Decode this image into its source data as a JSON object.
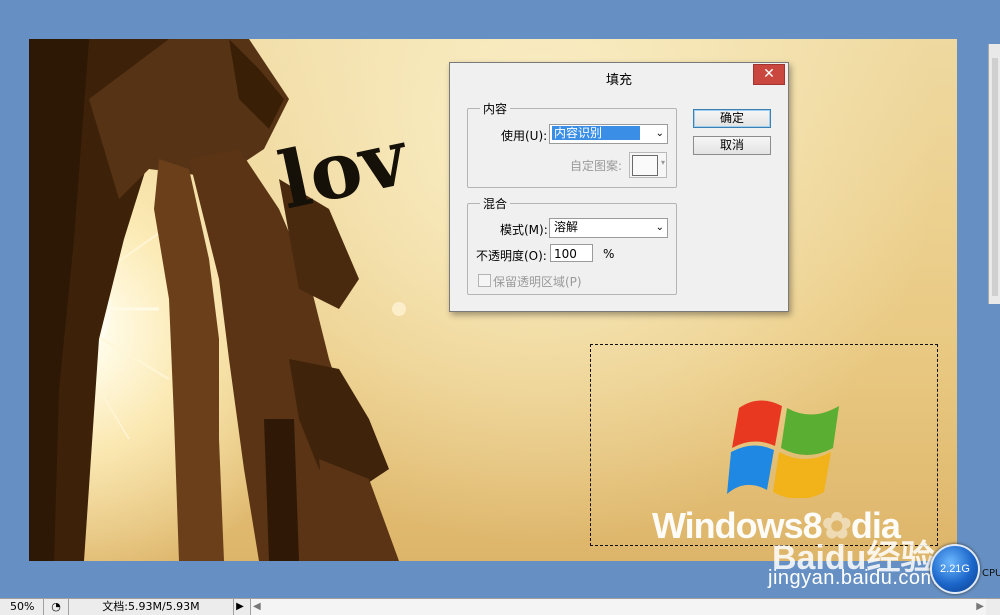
{
  "dialog": {
    "title": "填充",
    "close_glyph": "✕",
    "content_group": {
      "title": "内容",
      "use_label": "使用(U):",
      "use_value": "内容识别",
      "custom_pattern_label": "自定图案:"
    },
    "blend_group": {
      "title": "混合",
      "mode_label": "模式(M):",
      "mode_value": "溶解",
      "opacity_label": "不透明度(O):",
      "opacity_value": "100",
      "opacity_unit": "%",
      "preserve_transparency_label": "保留透明区域(P)",
      "preserve_transparency_checked": false
    },
    "ok_label": "确定",
    "cancel_label": "取消"
  },
  "statusbar": {
    "zoom": "50%",
    "doc_info": "文档:5.93M/5.93M",
    "arrow": "▶"
  },
  "watermark": {
    "windows_text": "Windows8",
    "windows_suffix": "dia",
    "baidu_text": "Baidu经验",
    "url": "jingyan.baidu.com"
  },
  "perf_badge": {
    "value": "2.21G",
    "label": "CPU"
  },
  "canvas_text": "lov",
  "colors": {
    "workspace": "#6690c3",
    "selection_highlight": "#3a8ee6",
    "close_button": "#c9473f"
  }
}
